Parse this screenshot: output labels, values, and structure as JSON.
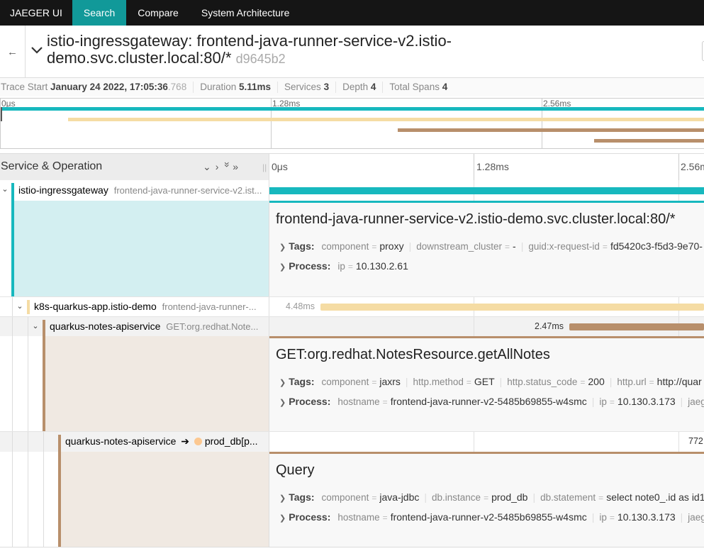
{
  "nav": {
    "brand": "JAEGER UI",
    "items": [
      {
        "label": "Search",
        "active": true
      },
      {
        "label": "Compare",
        "active": false
      },
      {
        "label": "System Architecture",
        "active": false
      }
    ]
  },
  "header": {
    "title": "istio-ingressgateway: frontend-java-runner-service-v2.istio-demo.svc.cluster.local:80/*",
    "trace_id": "d9645b2"
  },
  "summary": {
    "trace_start_label": "Trace Start",
    "trace_start_date": "January 24 2022, 17:05:36",
    "trace_start_ms": ".768",
    "duration_label": "Duration",
    "duration": "5.11ms",
    "services_label": "Services",
    "services": "3",
    "depth_label": "Depth",
    "depth": "4",
    "total_spans_label": "Total Spans",
    "total_spans": "4"
  },
  "minimap": {
    "ticks": [
      "0μs",
      "1.28ms",
      "2.56ms"
    ]
  },
  "timeline_header": {
    "label": "Service & Operation",
    "controls": [
      "⌵",
      "›",
      "»",
      "»"
    ],
    "ticks": [
      "0μs",
      "1.28ms",
      "2.56m"
    ]
  },
  "colors": {
    "ingress": "#17b8be",
    "k8s": "#f8dcа1",
    "quarkus": "#b88f6b",
    "nav_bg": "#151515",
    "nav_active": "#199999"
  },
  "spans": [
    {
      "service": "istio-ingressgateway",
      "operation": "frontend-java-runner-service-v2.ist...",
      "detail": {
        "title": "frontend-java-runner-service-v2.istio-demo.svc.cluster.local:80/*",
        "tags_label": "Tags:",
        "tags": [
          {
            "k": "component",
            "v": "proxy"
          },
          {
            "k": "downstream_cluster",
            "v": "-"
          },
          {
            "k": "guid:x-request-id",
            "v": "fd5420c3-f5d3-9e70-"
          }
        ],
        "process_label": "Process:",
        "process": [
          {
            "k": "ip",
            "v": "10.130.2.61"
          }
        ]
      }
    },
    {
      "service": "k8s-quarkus-app.istio-demo",
      "operation": "frontend-java-runner-...",
      "duration_label": "4.48ms"
    },
    {
      "service": "quarkus-notes-apiservice",
      "operation": "GET:org.redhat.Note...",
      "duration_label": "2.47ms",
      "detail": {
        "title": "GET:org.redhat.NotesResource.getAllNotes",
        "tags_label": "Tags:",
        "tags": [
          {
            "k": "component",
            "v": "jaxrs"
          },
          {
            "k": "http.method",
            "v": "GET"
          },
          {
            "k": "http.status_code",
            "v": "200"
          },
          {
            "k": "http.url",
            "v": "http://quar"
          }
        ],
        "process_label": "Process:",
        "process": [
          {
            "k": "hostname",
            "v": "frontend-java-runner-v2-5485b69855-w4smc"
          },
          {
            "k": "ip",
            "v": "10.130.3.173"
          },
          {
            "k": "jaeg",
            "v": ""
          }
        ]
      }
    },
    {
      "service": "quarkus-notes-apiservice",
      "arrow": "➔",
      "remote_service": "prod_db[p...",
      "duration_label": "772",
      "detail": {
        "title": "Query",
        "tags_label": "Tags:",
        "tags": [
          {
            "k": "component",
            "v": "java-jdbc"
          },
          {
            "k": "db.instance",
            "v": "prod_db"
          },
          {
            "k": "db.statement",
            "v": "select note0_.id as id1"
          }
        ],
        "process_label": "Process:",
        "process": [
          {
            "k": "hostname",
            "v": "frontend-java-runner-v2-5485b69855-w4smc"
          },
          {
            "k": "ip",
            "v": "10.130.3.173"
          },
          {
            "k": "jaeg",
            "v": ""
          }
        ]
      }
    }
  ]
}
